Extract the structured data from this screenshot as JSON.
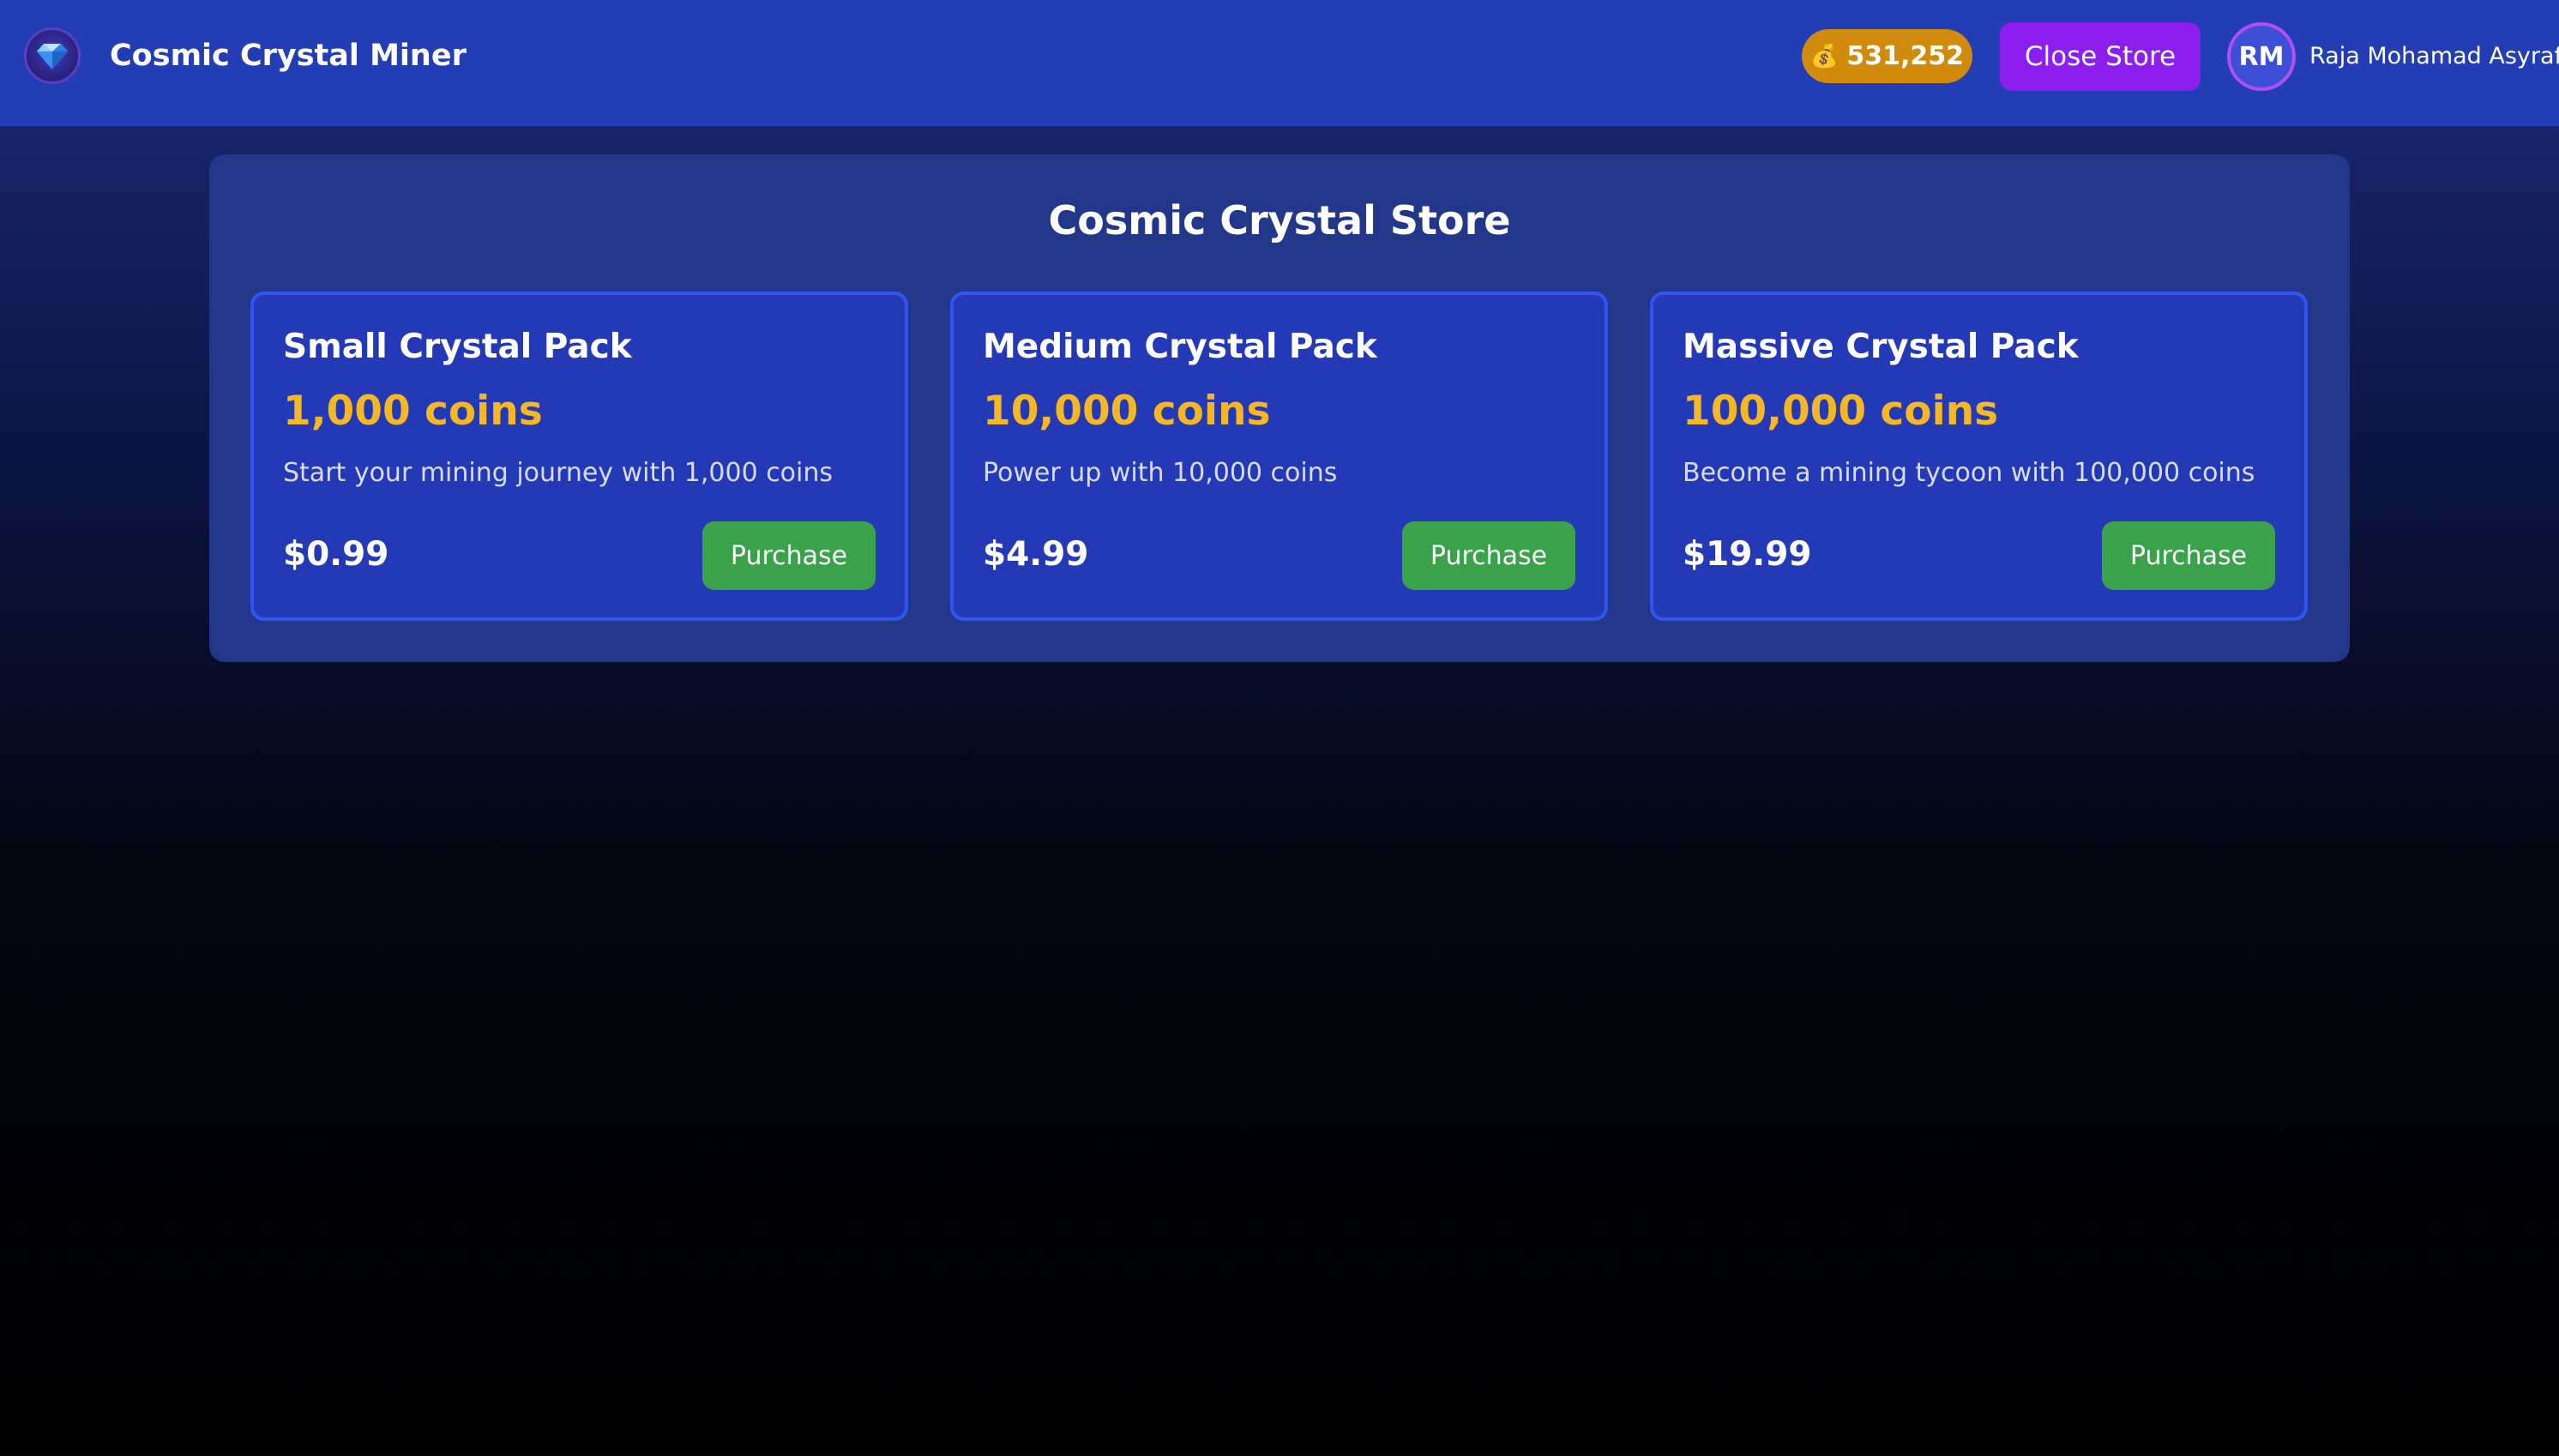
{
  "header": {
    "app_title": "Cosmic Crystal Miner",
    "logo_icon": "crystal-gem-icon",
    "coin_balance": "531,252",
    "coin_icon": "money-bag-icon",
    "close_store_label": "Close Store",
    "avatar_initials": "RM",
    "user_name": "Raja Mohamad Asyraf"
  },
  "store": {
    "title": "Cosmic Crystal Store",
    "packs": [
      {
        "name": "Small Crystal Pack",
        "coins": "1,000 coins",
        "description": "Start your mining journey with 1,000 coins",
        "price": "$0.99",
        "button_label": "Purchase"
      },
      {
        "name": "Medium Crystal Pack",
        "coins": "10,000 coins",
        "description": "Power up with 10,000 coins",
        "price": "$4.99",
        "button_label": "Purchase"
      },
      {
        "name": "Massive Crystal Pack",
        "coins": "100,000 coins",
        "description": "Become a mining tycoon with 100,000 coins",
        "price": "$19.99",
        "button_label": "Purchase"
      }
    ]
  },
  "colors": {
    "header_bg": "#233db5",
    "coin_badge_bg": "#d18b0b",
    "close_button_bg": "#8c1ff0",
    "card_bg": "#2439b6",
    "card_border": "#2f56f0",
    "coins_text": "#f5b723",
    "purchase_button_bg": "#3aa24a"
  }
}
